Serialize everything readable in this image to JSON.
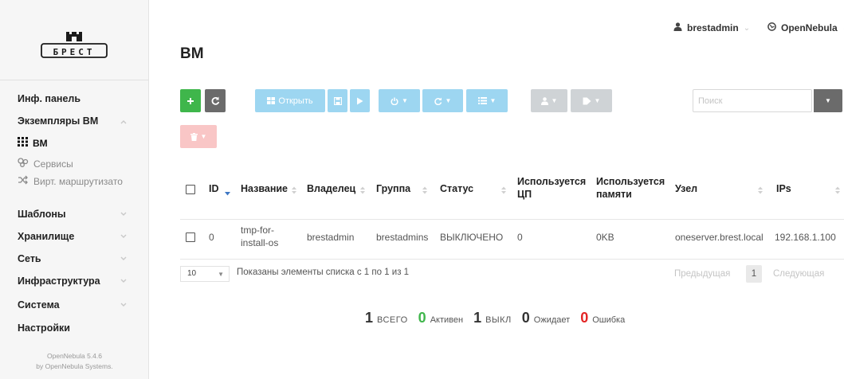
{
  "brand": {
    "logo_text": "БРЕСТ"
  },
  "sidebar": {
    "dashboard": "Инф. панель",
    "instances": "Экземпляры ВМ",
    "vms": "ВМ",
    "services": "Сервисы",
    "vrouters": "Вирт. маршрутизато",
    "templates": "Шаблоны",
    "storage": "Хранилище",
    "network": "Сеть",
    "infrastructure": "Инфраструктура",
    "system": "Система",
    "settings": "Настройки",
    "footer_version": "OpenNebula 5.4.6",
    "footer_by": "by OpenNebula Systems."
  },
  "topbar": {
    "user": "brestadmin",
    "zone": "OpenNebula"
  },
  "page": {
    "title": "ВМ"
  },
  "toolbar": {
    "open_label": "Открыть",
    "search_placeholder": "Поиск"
  },
  "table": {
    "headers": {
      "id": "ID",
      "name": "Название",
      "owner": "Владелец",
      "group": "Группа",
      "status": "Статус",
      "cpu_l1": "Используется",
      "cpu_l2": "ЦП",
      "mem_l1": "Используется",
      "mem_l2": "памяти",
      "host": "Узел",
      "ips": "IPs"
    },
    "rows": [
      {
        "id": "0",
        "name_l1": "tmp-for-",
        "name_l2": "install-os",
        "owner": "brestadmin",
        "group": "brestadmins",
        "status": "ВЫКЛЮЧЕНО",
        "cpu": "0",
        "memory": "0KB",
        "host": "oneserver.brest.local",
        "ip": "192.168.1.100"
      }
    ]
  },
  "pagination": {
    "page_size": "10",
    "info": "Показаны элементы списка с 1 по 1 из 1",
    "prev": "Предыдущая",
    "current": "1",
    "next": "Следующая"
  },
  "summary": {
    "total_count": "1",
    "total_label": "ВСЕГО",
    "active_count": "0",
    "active_label": "Активен",
    "off_count": "1",
    "off_label": "ВЫКЛ",
    "pending_count": "0",
    "pending_label": "Ожидает",
    "error_count": "0",
    "error_label": "Ошибка"
  },
  "colors": {
    "green": "#3fb64b",
    "red": "#e32525",
    "accent_blue": "#9dd6f1",
    "sort_active": "#3e77c4"
  },
  "icons": [
    "user-icon",
    "globe-icon",
    "plus-icon",
    "refresh-icon",
    "grid-icon",
    "save-icon",
    "play-icon",
    "power-icon",
    "reload-icon",
    "list-icon",
    "tag-icon",
    "trash-icon",
    "caret-down-icon",
    "sort-icon",
    "services-icon",
    "shuffle-icon"
  ]
}
